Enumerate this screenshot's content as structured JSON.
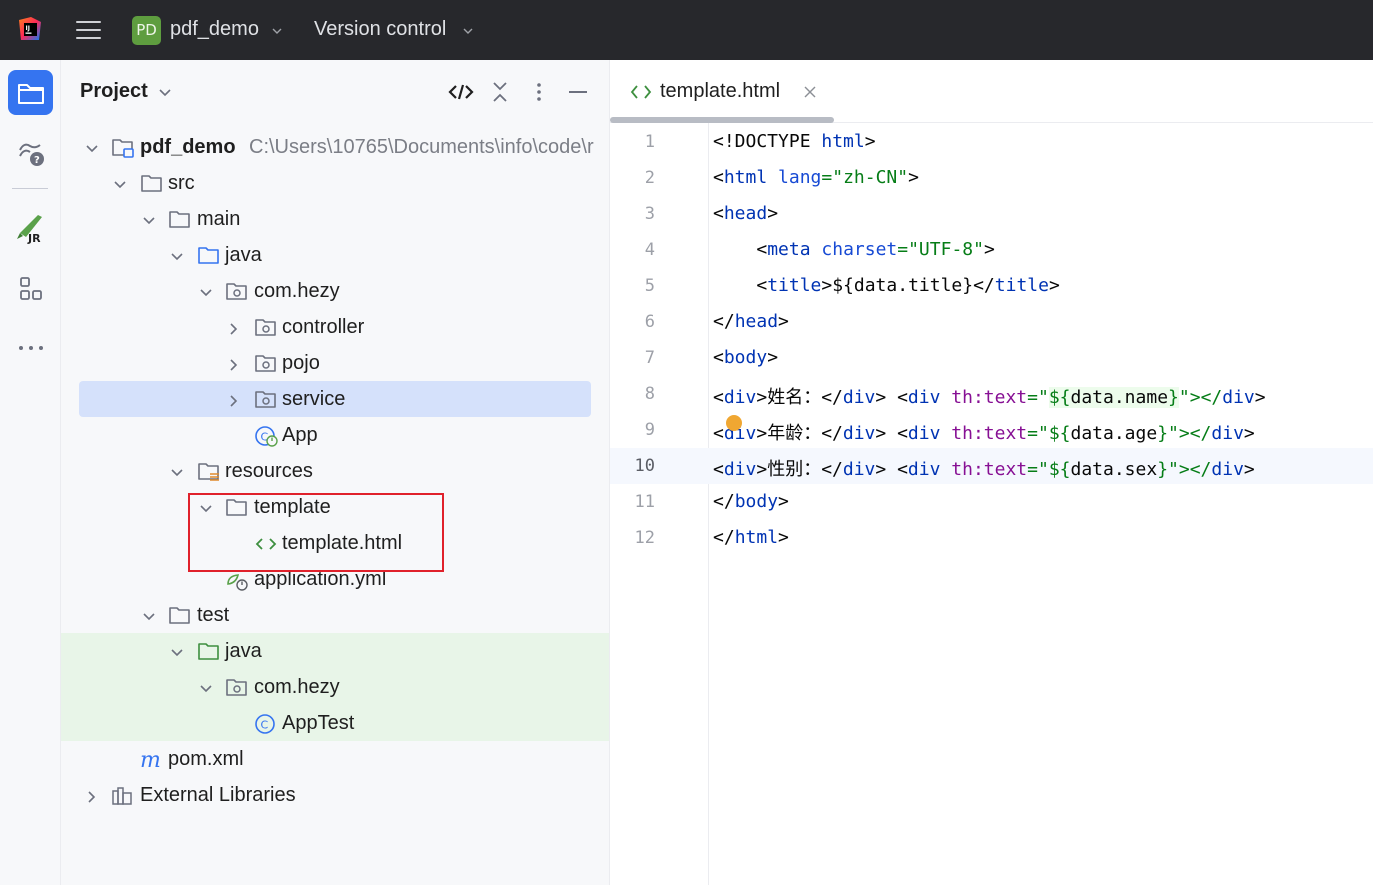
{
  "titlebar": {
    "app_icon": "intellij-idea-logo",
    "menu_icon": "hamburger-menu-icon",
    "project_badge": "PD",
    "project_name": "pdf_demo",
    "vcs_label": "Version control",
    "colors": {
      "background": "#27282c",
      "badge": "#5e9d3f",
      "text": "#dfe1e5"
    }
  },
  "toolstrip": {
    "items": [
      "project-folder-icon",
      "learn-help-icon",
      "jrebel-rocket-icon",
      "structure-icon",
      "more-tools-icon"
    ],
    "active_color": "#3574f0"
  },
  "project_panel": {
    "title": "Project",
    "actions": [
      "select-opened-file-icon",
      "collapse-all-icon",
      "options-icon",
      "hide-panel-icon"
    ],
    "tree": [
      {
        "label": "pdf_demo",
        "path": "C:\\Users\\10765\\Documents\\info\\code\\r",
        "icon": "module-folder-icon",
        "expanded": true
      },
      {
        "label": "src",
        "icon": "folder-icon",
        "expanded": true
      },
      {
        "label": "main",
        "icon": "folder-icon",
        "expanded": true
      },
      {
        "label": "java",
        "icon": "source-root-folder-icon",
        "expanded": true
      },
      {
        "label": "com.hezy",
        "icon": "package-icon",
        "expanded": true
      },
      {
        "label": "controller",
        "icon": "package-icon",
        "expanded": false
      },
      {
        "label": "pojo",
        "icon": "package-icon",
        "expanded": false
      },
      {
        "label": "service",
        "icon": "package-icon",
        "expanded": false,
        "selected": true
      },
      {
        "label": "App",
        "icon": "spring-boot-class-icon"
      },
      {
        "label": "resources",
        "icon": "resources-root-folder-icon",
        "expanded": true
      },
      {
        "label": "template",
        "icon": "folder-icon",
        "expanded": true
      },
      {
        "label": "template.html",
        "icon": "html-file-icon"
      },
      {
        "label": "application.yml",
        "icon": "spring-config-icon"
      },
      {
        "label": "test",
        "icon": "folder-icon",
        "expanded": true
      },
      {
        "label": "java",
        "icon": "test-root-folder-icon",
        "expanded": true
      },
      {
        "label": "com.hezy",
        "icon": "package-icon",
        "expanded": true
      },
      {
        "label": "AppTest",
        "icon": "class-icon"
      },
      {
        "label": "pom.xml",
        "icon": "maven-icon"
      },
      {
        "label": "External Libraries",
        "icon": "libraries-icon",
        "expanded": false
      }
    ],
    "colors": {
      "selection": "#d5e1fb",
      "test_scope": "#e8f5e8",
      "annotation_box": "#e0212b"
    }
  },
  "editor": {
    "tab": {
      "label": "template.html",
      "icon": "html-file-icon",
      "close_icon": "close-icon"
    },
    "current_line": 10,
    "lines": [
      {
        "n": "1"
      },
      {
        "n": "2"
      },
      {
        "n": "3"
      },
      {
        "n": "4"
      },
      {
        "n": "5"
      },
      {
        "n": "6"
      },
      {
        "n": "7"
      },
      {
        "n": "8"
      },
      {
        "n": "9"
      },
      {
        "n": "10"
      },
      {
        "n": "11"
      },
      {
        "n": "12"
      }
    ],
    "code": {
      "l1": [
        "<!DOCTYPE ",
        "html",
        ">"
      ],
      "l2": [
        "<",
        "html",
        " ",
        "lang",
        "=",
        "\"zh-CN\"",
        ">"
      ],
      "l3": [
        "<",
        "head",
        ">"
      ],
      "l4": [
        "    <",
        "meta",
        " ",
        "charset",
        "=",
        "\"UTF-8\"",
        ">"
      ],
      "l5": [
        "    <",
        "title",
        ">${data.title}</",
        "title",
        ">"
      ],
      "l6": [
        "</",
        "head",
        ">"
      ],
      "l7": [
        "<",
        "body",
        ">"
      ],
      "l8": [
        "<",
        "div",
        ">姓名：</",
        "div",
        "> <",
        "div",
        " ",
        "th:text",
        "=\"",
        "${",
        "data.name",
        "}",
        "\"></",
        "div",
        ">"
      ],
      "l9": [
        "<",
        "div",
        ">年龄：</",
        "div",
        "> <",
        "div",
        " ",
        "th:text",
        "=\"",
        "${",
        "data.age",
        "}",
        "\"></",
        "div",
        ">"
      ],
      "l10": [
        "<",
        "div",
        ">性别：</",
        "div",
        "> <",
        "div",
        " ",
        "th:text",
        "=\"",
        "${",
        "data.sex",
        "}",
        "\"></",
        "div",
        ">"
      ],
      "l11": [
        "</",
        "body",
        ">"
      ],
      "l12": [
        "</",
        "html",
        ">"
      ]
    },
    "intention_icon": "intention-bulb-icon",
    "colors": {
      "tag": "#0033b3",
      "attr": "#174ad4",
      "value": "#067d17",
      "thymeleaf_attr": "#871094",
      "current_line": "#f5f8fe"
    }
  }
}
